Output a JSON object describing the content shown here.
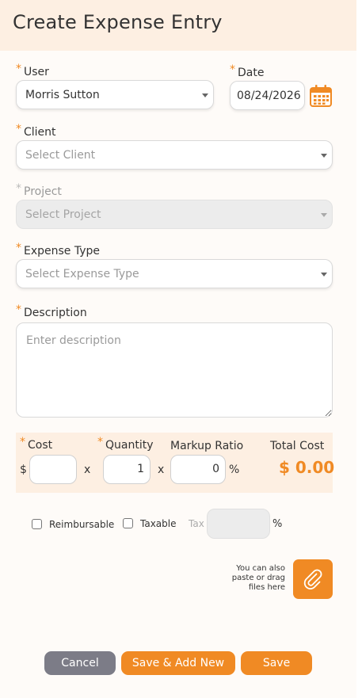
{
  "header": {
    "title": "Create Expense Entry"
  },
  "user": {
    "label": "User",
    "value": "Morris Sutton"
  },
  "date": {
    "label": "Date",
    "value": "08/24/2026"
  },
  "client": {
    "label": "Client",
    "placeholder": "Select Client"
  },
  "project": {
    "label": "Project",
    "placeholder": "Select Project"
  },
  "expense_type": {
    "label": "Expense Type",
    "placeholder": "Select Expense Type"
  },
  "description": {
    "label": "Description",
    "placeholder": "Enter description"
  },
  "cost_panel": {
    "cost_label": "Cost",
    "currency_symbol": "$",
    "cost_value": "",
    "times": "x",
    "quantity_label": "Quantity",
    "quantity_value": "1",
    "markup_label": "Markup Ratio",
    "markup_value": "0",
    "percent": "%",
    "total_label": "Total Cost",
    "total_value": "$ 0.00"
  },
  "options": {
    "reimbursable_label": "Reimbursable",
    "taxable_label": "Taxable",
    "tax_label": "Tax",
    "tax_percent": "%"
  },
  "attachment": {
    "note": "You can also paste or drag files here"
  },
  "actions": {
    "cancel": "Cancel",
    "save_add_new": "Save & Add New",
    "save": "Save"
  },
  "colors": {
    "accent": "#f08a24",
    "header_bg": "#fdefe2",
    "cancel_bg": "#7c7c87"
  }
}
